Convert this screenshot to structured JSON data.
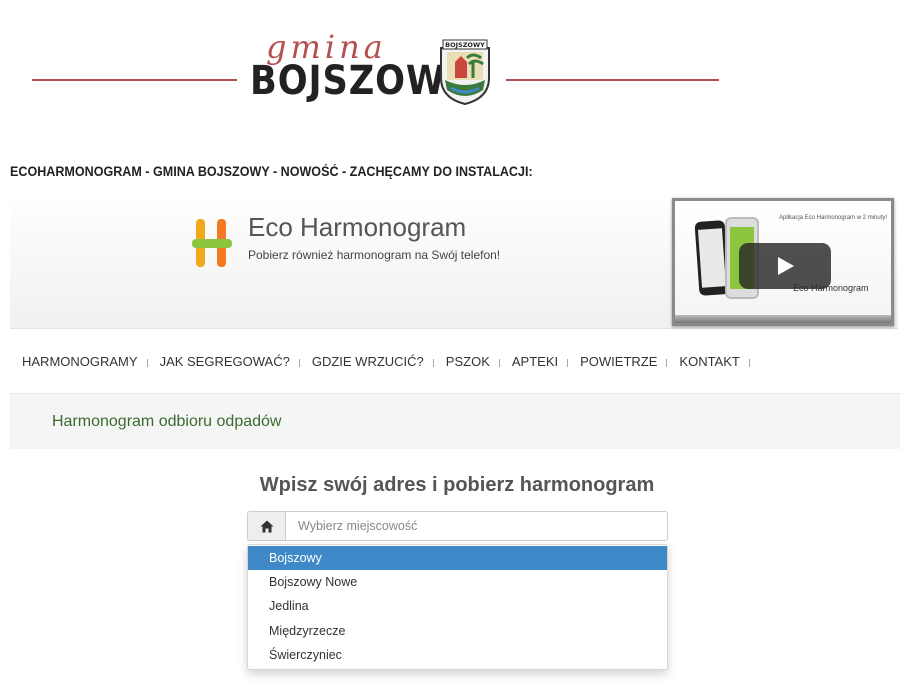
{
  "header": {
    "gmina_script": "gmina",
    "brand": "BOJSZOWY",
    "crest_label": "BOJSZOWY",
    "colors": {
      "accent_red": "#b5504e"
    }
  },
  "notice": "ECOHARMONOGRAM - GMINA BOJSZOWY - NOWOŚĆ - ZACHĘCAMY DO INSTALACJI:",
  "banner": {
    "title": "Eco Harmonogram",
    "subtitle": "Pobierz również harmonogram na Swój telefon!",
    "video": {
      "caption": "Aplikacja Eco Harmonogram w 2 minuty!",
      "brand": "Eco Harmonogram",
      "icon": "play-icon"
    }
  },
  "nav": {
    "items": [
      {
        "label": "HARMONOGRAMY"
      },
      {
        "label": "JAK SEGREGOWAĆ?"
      },
      {
        "label": "GDZIE WRZUCIĆ?"
      },
      {
        "label": "PSZOK"
      },
      {
        "label": "APTEKI"
      },
      {
        "label": "POWIETRZE"
      },
      {
        "label": "KONTAKT"
      }
    ]
  },
  "section": {
    "title": "Harmonogram odbioru odpadów",
    "color": "#3c6b2f"
  },
  "search": {
    "heading": "Wpisz swój adres i pobierz harmonogram",
    "placeholder": "Wybierz miejscowość",
    "value": "",
    "icon": "home-icon",
    "options": [
      {
        "label": "Bojszowy",
        "selected": true
      },
      {
        "label": "Bojszowy Nowe"
      },
      {
        "label": "Jedlina"
      },
      {
        "label": "Międzyrzecze"
      },
      {
        "label": "Świerczyniec"
      }
    ],
    "highlight_color": "#3f89c9"
  }
}
